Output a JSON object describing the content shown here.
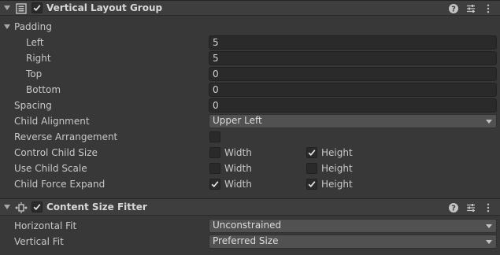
{
  "vertical_layout_group": {
    "title": "Vertical Layout Group",
    "enabled": true,
    "icon": "layout-group-icon",
    "padding": {
      "label": "Padding",
      "left_label": "Left",
      "left_value": "5",
      "right_label": "Right",
      "right_value": "5",
      "top_label": "Top",
      "top_value": "0",
      "bottom_label": "Bottom",
      "bottom_value": "0"
    },
    "spacing_label": "Spacing",
    "spacing_value": "0",
    "child_alignment_label": "Child Alignment",
    "child_alignment_value": "Upper Left",
    "reverse_arrangement_label": "Reverse Arrangement",
    "reverse_arrangement_checked": false,
    "control_child_size_label": "Control Child Size",
    "use_child_scale_label": "Use Child Scale",
    "child_force_expand_label": "Child Force Expand",
    "width_label": "Width",
    "height_label": "Height",
    "toggles": {
      "control_child_size": {
        "width": false,
        "height": true
      },
      "use_child_scale": {
        "width": false,
        "height": false
      },
      "child_force_expand": {
        "width": true,
        "height": true
      }
    }
  },
  "content_size_fitter": {
    "title": "Content Size Fitter",
    "enabled": true,
    "icon": "content-size-fitter-icon",
    "horizontal_fit_label": "Horizontal Fit",
    "horizontal_fit_value": "Unconstrained",
    "vertical_fit_label": "Vertical Fit",
    "vertical_fit_value": "Preferred Size"
  },
  "header_tools": [
    "help-icon",
    "preset-sliders-icon",
    "more-vertical-icon"
  ],
  "colors": {
    "background": "#383838",
    "header": "#3e3e3e",
    "field": "#2a2a2a",
    "dropdown": "#515151"
  }
}
